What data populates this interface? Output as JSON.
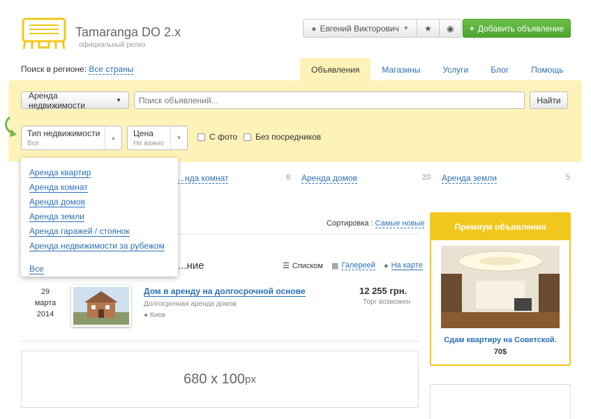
{
  "brand": {
    "name": "Tamaranga DO 2.x",
    "slogan": "официальный релиз"
  },
  "user": {
    "name": "Евгений Викторович",
    "add_label": "Добавить объявление"
  },
  "region": {
    "label": "Поиск в регионе:",
    "value": "Все страны"
  },
  "tabs": [
    {
      "label": "Объявления",
      "active": true
    },
    {
      "label": "Магазины"
    },
    {
      "label": "Услуги"
    },
    {
      "label": "Блог"
    },
    {
      "label": "Помощь"
    }
  ],
  "search": {
    "category": "Аренда недвижимости",
    "placeholder": "Поиск объявлений...",
    "find_label": "Найти"
  },
  "filters": {
    "type_label": "Тип недвижимости",
    "type_value": "Все",
    "price_label": "Цена",
    "price_value": "Не важно",
    "photo_label": "С фото",
    "noagent_label": "Без посредников"
  },
  "category_counts": [
    {
      "label": "...нда комнат",
      "count": "8"
    },
    {
      "label": "Аренда домов",
      "count": "20"
    },
    {
      "label": "Аренда земли",
      "count": "5"
    }
  ],
  "dropdown": {
    "items": [
      "Аренда квартир",
      "Аренда комнат",
      "Аренда домов",
      "Аренда земли",
      "Аренда гаражей / стоянок",
      "Аренда недвижимости за рубежом"
    ],
    "all": "Все"
  },
  "sort": {
    "label": "Сортировка :",
    "value": "Самые новые"
  },
  "list": {
    "title": "...ние",
    "views": [
      "Списком",
      "Галерeей",
      "На карте"
    ]
  },
  "listing": {
    "date_day": "29 марта",
    "date_year": "2014",
    "title": "Дом в аренду на долгосрочной основе",
    "category": "Долгосрочная аренда домов",
    "city": "Киев",
    "price": "12 255 грн.",
    "bargain": "Торг возможен"
  },
  "banner": {
    "size": "680 x 100",
    "unit": "px"
  },
  "premium": {
    "header": "Премиум объявления",
    "title": "Сдам квартиру на Советской.",
    "price": "70$"
  },
  "colors": {
    "accent": "#f2c71d",
    "link": "#2a6fb7",
    "green": "#5cb33c",
    "panel": "#fdf3b8"
  }
}
